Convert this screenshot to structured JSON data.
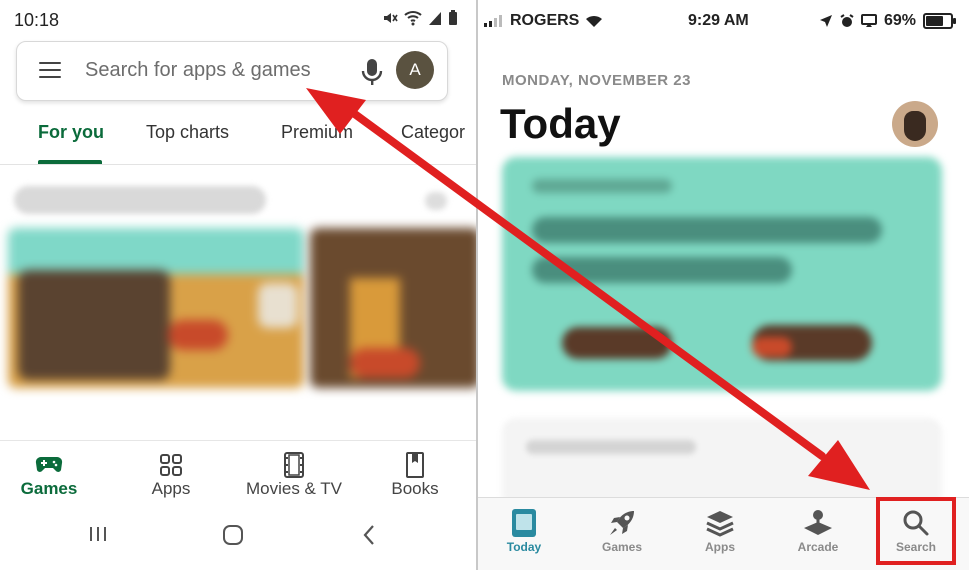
{
  "android": {
    "status": {
      "time": "10:18"
    },
    "search": {
      "placeholder": "Search for apps & games",
      "avatar_letter": "A"
    },
    "tabs": [
      "For you",
      "Top charts",
      "Premium",
      "Categor"
    ],
    "bottom_nav": [
      "Games",
      "Apps",
      "Movies & TV",
      "Books"
    ],
    "accent_color": "#0b6b3b"
  },
  "ios": {
    "status": {
      "carrier": "ROGERS",
      "time": "9:29 AM",
      "battery": "69%"
    },
    "date": "MONDAY, NOVEMBER 23",
    "title": "Today",
    "tabs": [
      "Today",
      "Games",
      "Apps",
      "Arcade",
      "Search"
    ],
    "accent_color": "#2a8aa0"
  },
  "annotation": {
    "arrow_color": "#e02020",
    "highlighted_tab": "Search"
  }
}
